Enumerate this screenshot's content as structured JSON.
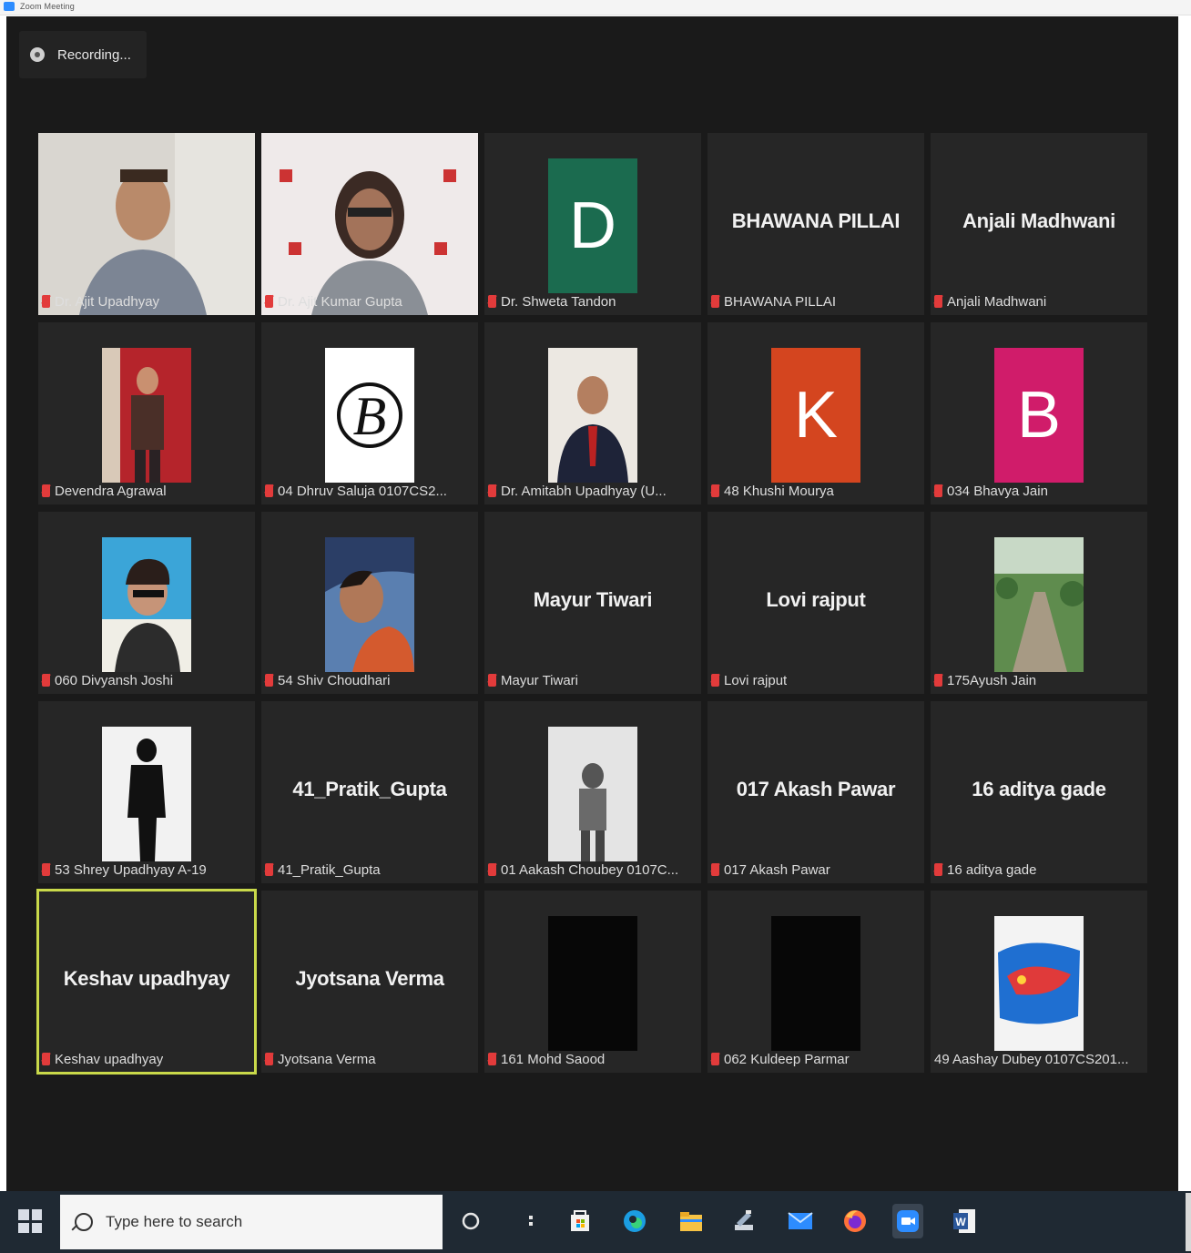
{
  "window": {
    "title": "Zoom Meeting"
  },
  "recording": {
    "label": "Recording..."
  },
  "participants": [
    {
      "big": "",
      "label": "Dr. Ajit Upadhyay",
      "kind": "video-man"
    },
    {
      "big": "",
      "label": "Dr. Ajit Kumar Gupta",
      "kind": "video-woman"
    },
    {
      "big": "D",
      "label": "Dr. Shweta Tandon",
      "kind": "letter",
      "color": "#1b6b4f"
    },
    {
      "big": "BHAWANA PILLAI",
      "label": "BHAWANA PILLAI",
      "kind": "text"
    },
    {
      "big": "Anjali Madhwani",
      "label": "Anjali Madhwani",
      "kind": "text"
    },
    {
      "big": "",
      "label": "Devendra Agrawal",
      "kind": "photo-red"
    },
    {
      "big": "",
      "label": "04 Dhruv Saluja 0107CS2...",
      "kind": "photo-logo"
    },
    {
      "big": "",
      "label": "Dr. Amitabh Upadhyay (U...",
      "kind": "photo-suit"
    },
    {
      "big": "K",
      "label": "48 Khushi Mourya",
      "kind": "letter",
      "color": "#d4451f"
    },
    {
      "big": "B",
      "label": "034 Bhavya Jain",
      "kind": "letter",
      "color": "#d01c6a"
    },
    {
      "big": "",
      "label": "060 Divyansh Joshi",
      "kind": "photo-boy"
    },
    {
      "big": "",
      "label": "54 Shiv Choudhari",
      "kind": "photo-selfie"
    },
    {
      "big": "Mayur Tiwari",
      "label": "Mayur Tiwari",
      "kind": "text"
    },
    {
      "big": "Lovi rajput",
      "label": "Lovi rajput",
      "kind": "text"
    },
    {
      "big": "",
      "label": "175Ayush Jain",
      "kind": "photo-green"
    },
    {
      "big": "",
      "label": "53 Shrey Upadhyay A-19",
      "kind": "photo-silhouette"
    },
    {
      "big": "41_Pratik_Gupta",
      "label": "41_Pratik_Gupta",
      "kind": "text"
    },
    {
      "big": "",
      "label": "01 Aakash Choubey 0107C...",
      "kind": "photo-gray"
    },
    {
      "big": "017 Akash Pawar",
      "label": "017 Akash Pawar",
      "kind": "text"
    },
    {
      "big": "16 aditya gade",
      "label": "16 aditya gade",
      "kind": "text"
    },
    {
      "big": "Keshav upadhyay",
      "label": "Keshav upadhyay",
      "kind": "text",
      "active": true
    },
    {
      "big": "Jyotsana Verma",
      "label": "Jyotsana Verma",
      "kind": "text"
    },
    {
      "big": "",
      "label": "161 Mohd Saood",
      "kind": "photo-black"
    },
    {
      "big": "",
      "label": "062 Kuldeep Parmar",
      "kind": "photo-black"
    },
    {
      "big": "",
      "label": "49 Aashay Dubey 0107CS201...",
      "kind": "photo-graffiti",
      "nomic": true
    }
  ],
  "taskbar": {
    "search_placeholder": "Type here to search",
    "icons": [
      "cortana-icon",
      "task-view-icon",
      "store-icon",
      "edge-icon",
      "file-explorer-icon",
      "tool-icon",
      "mail-icon",
      "firefox-icon",
      "zoom-icon",
      "word-icon"
    ]
  }
}
